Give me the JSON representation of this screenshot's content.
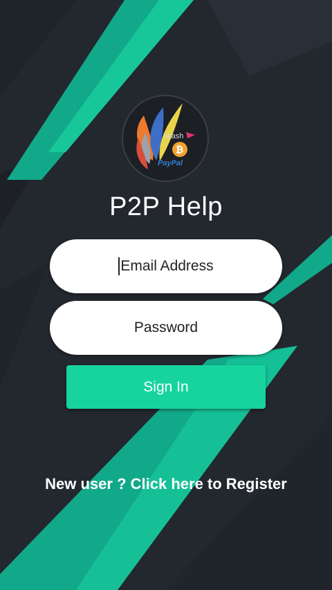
{
  "app": {
    "title": "P2P Help",
    "logo_text": {
      "brand1": "hkash",
      "brand2": "PayPal",
      "coin_symbol": "₿"
    }
  },
  "form": {
    "email_placeholder": "Email Address",
    "password_placeholder": "Password",
    "signin_label": "Sign In"
  },
  "footer": {
    "register_link": "New user ? Click here to Register"
  },
  "colors": {
    "background": "#23272e",
    "accent": "#17d49f",
    "stripe": "#12a98a"
  }
}
